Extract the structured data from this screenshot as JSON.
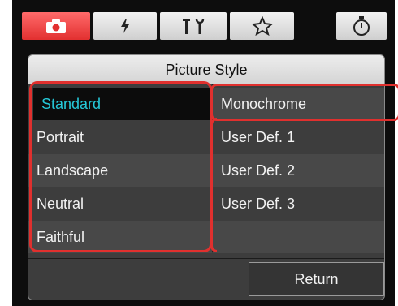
{
  "tabs": [
    {
      "icon": "camera-icon",
      "active": true
    },
    {
      "icon": "flash-icon",
      "active": false
    },
    {
      "icon": "tools-icon",
      "active": false
    },
    {
      "icon": "star-icon",
      "active": false
    },
    {
      "icon": "timer-icon",
      "active": false
    }
  ],
  "panel": {
    "title": "Picture Style",
    "left_column": [
      "Standard",
      "Portrait",
      "Landscape",
      "Neutral",
      "Faithful"
    ],
    "right_column": [
      "Monochrome",
      "User Def. 1",
      "User Def. 2",
      "User Def. 3",
      ""
    ],
    "selected": "Standard",
    "return_label": "Return"
  },
  "colors": {
    "active_tab": "#e23030",
    "selected_text": "#25c8d8",
    "highlight_box": "#e0302e"
  }
}
